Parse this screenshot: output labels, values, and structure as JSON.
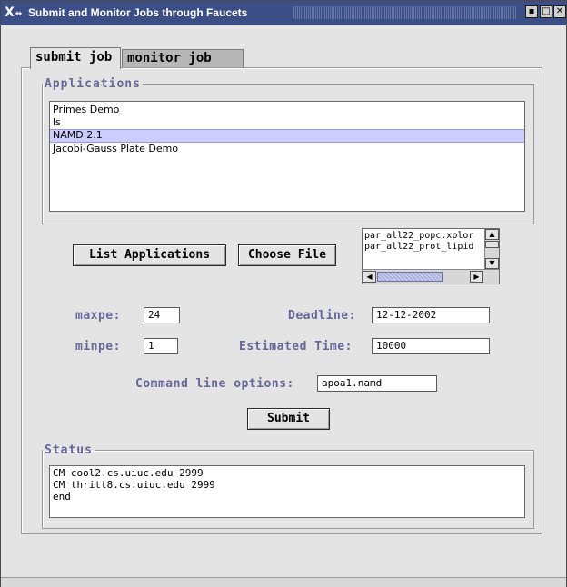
{
  "window": {
    "title": "Submit and Monitor Jobs through Faucets",
    "logo": "X",
    "controls": [
      "minimize-icon",
      "maximize-icon",
      "close-icon"
    ]
  },
  "tabs": [
    {
      "label": "submit job",
      "active": true
    },
    {
      "label": "monitor job",
      "active": false
    }
  ],
  "applications": {
    "legend": "Applications",
    "items": [
      "Primes Demo",
      "ls",
      "NAMD 2.1",
      "Jacobi-Gauss Plate Demo"
    ],
    "selected": "NAMD 2.1"
  },
  "buttons": {
    "list_applications": "List Applications",
    "choose_file": "Choose File",
    "submit": "Submit"
  },
  "files": {
    "items": [
      "par_all22_popc.xplor",
      "par_all22_prot_lipid"
    ]
  },
  "form": {
    "maxpe_label": "maxpe:",
    "maxpe_value": "24",
    "minpe_label": "minpe:",
    "minpe_value": "1",
    "deadline_label": "Deadline:",
    "deadline_value": "12-12-2002",
    "estimated_label": "Estimated Time:",
    "estimated_value": "10000",
    "cmd_label": "Command line options:",
    "cmd_value": "apoa1.namd"
  },
  "status": {
    "legend": "Status",
    "lines": [
      "CM cool2.cs.uiuc.edu 2999",
      "CM thritt8.cs.uiuc.edu 2999",
      "end"
    ]
  }
}
